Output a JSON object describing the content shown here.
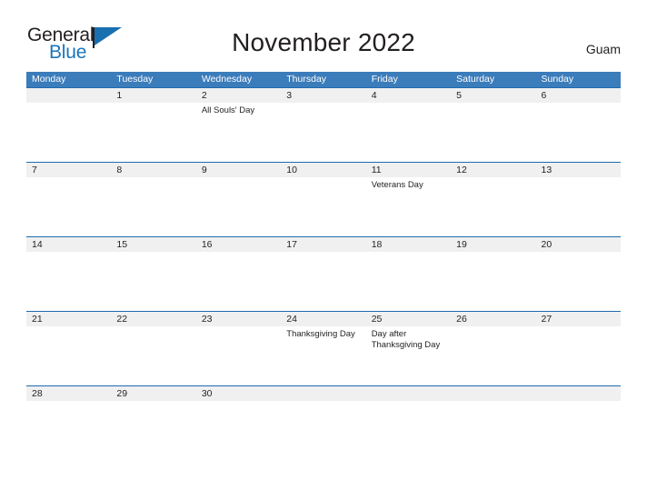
{
  "brand": {
    "name_line1": "General",
    "name_line2": "Blue",
    "flag_icon": "flag-triangle-icon"
  },
  "header": {
    "title": "November 2022",
    "region": "Guam"
  },
  "calendar": {
    "weekdays": [
      "Monday",
      "Tuesday",
      "Wednesday",
      "Thursday",
      "Friday",
      "Saturday",
      "Sunday"
    ],
    "colors": {
      "header_bar": "#3b7cbb",
      "row_rule": "#1f6bb0",
      "date_band": "#f0f0f0",
      "brand_blue": "#1a75bb",
      "text": "#231f20"
    },
    "weeks": [
      {
        "days": [
          {
            "date": "",
            "event": ""
          },
          {
            "date": "1",
            "event": ""
          },
          {
            "date": "2",
            "event": "All Souls' Day"
          },
          {
            "date": "3",
            "event": ""
          },
          {
            "date": "4",
            "event": ""
          },
          {
            "date": "5",
            "event": ""
          },
          {
            "date": "6",
            "event": ""
          }
        ]
      },
      {
        "days": [
          {
            "date": "7",
            "event": ""
          },
          {
            "date": "8",
            "event": ""
          },
          {
            "date": "9",
            "event": ""
          },
          {
            "date": "10",
            "event": ""
          },
          {
            "date": "11",
            "event": "Veterans Day"
          },
          {
            "date": "12",
            "event": ""
          },
          {
            "date": "13",
            "event": ""
          }
        ]
      },
      {
        "days": [
          {
            "date": "14",
            "event": ""
          },
          {
            "date": "15",
            "event": ""
          },
          {
            "date": "16",
            "event": ""
          },
          {
            "date": "17",
            "event": ""
          },
          {
            "date": "18",
            "event": ""
          },
          {
            "date": "19",
            "event": ""
          },
          {
            "date": "20",
            "event": ""
          }
        ]
      },
      {
        "days": [
          {
            "date": "21",
            "event": ""
          },
          {
            "date": "22",
            "event": ""
          },
          {
            "date": "23",
            "event": ""
          },
          {
            "date": "24",
            "event": "Thanksgiving Day"
          },
          {
            "date": "25",
            "event": "Day after Thanksgiving Day"
          },
          {
            "date": "26",
            "event": ""
          },
          {
            "date": "27",
            "event": ""
          }
        ]
      },
      {
        "days": [
          {
            "date": "28",
            "event": ""
          },
          {
            "date": "29",
            "event": ""
          },
          {
            "date": "30",
            "event": ""
          },
          {
            "date": "",
            "event": ""
          },
          {
            "date": "",
            "event": ""
          },
          {
            "date": "",
            "event": ""
          },
          {
            "date": "",
            "event": ""
          }
        ]
      }
    ]
  }
}
